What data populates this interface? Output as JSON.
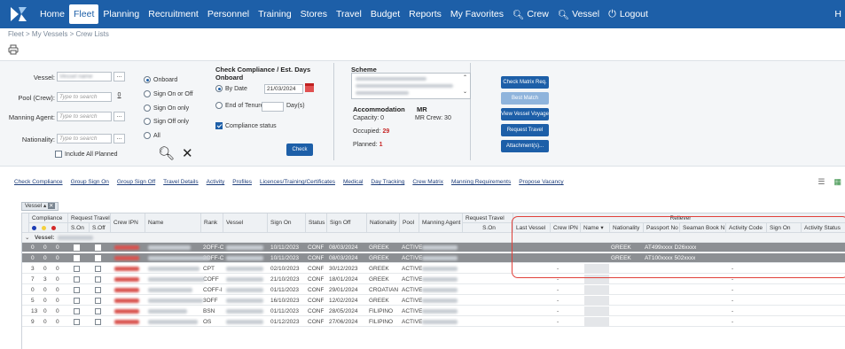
{
  "nav": {
    "items": [
      "Home",
      "Fleet",
      "Planning",
      "Recruitment",
      "Personnel",
      "Training",
      "Stores",
      "Travel",
      "Budget",
      "Reports",
      "My Favorites",
      "Crew",
      "Vessel",
      "Logout"
    ],
    "active": "Fleet",
    "right_text": "H"
  },
  "breadcrumb": "Fleet > My Vessels > Crew Lists",
  "filters": {
    "vessel_label": "Vessel:",
    "pool_label": "Pool (Crew):",
    "pool_placeholder": "Type to search",
    "pool_count": "0",
    "manning_label": "Manning Agent:",
    "manning_placeholder": "Type to search",
    "nationality_label": "Nationality:",
    "nationality_placeholder": "Type to search",
    "include_all_planned": "Include All Planned",
    "radios": [
      "Onboard",
      "Sign On or Off",
      "Sign On only",
      "Sign Off only",
      "All"
    ],
    "radio_selected": "Onboard"
  },
  "compliance": {
    "title": "Check Compliance / Est. Days Onboard",
    "by_date": "By Date",
    "date_value": "21/03/2024",
    "end_of_tenure": "End of Tenure",
    "days_label": "Day(s)",
    "compliance_status": "Compliance status",
    "check_button": "Check"
  },
  "scheme": {
    "title": "Scheme",
    "accommodation": "Accommodation",
    "mr": "MR",
    "capacity": "Capacity: 0",
    "mr_crew": "MR Crew: 30",
    "occupied_label": "Occupied:",
    "occupied_value": "29",
    "planned_label": "Planned:",
    "planned_value": "1"
  },
  "action_buttons": [
    "Check Matrix Req.",
    "Best Match",
    "View Vessel Voyage",
    "Request Travel",
    "Attachment(s)..."
  ],
  "links": [
    "Check Compliance",
    "Group Sign On",
    "Group Sign Off",
    "Travel Details",
    "Activity",
    "Profiles",
    "Licences/Training/Certificates",
    "Medical",
    "Day Tracking",
    "Crew Matrix",
    "Manning Requirements",
    "Propose Vacancy"
  ],
  "grid": {
    "tab_label": "Vessel",
    "group_compliance": "Compliance",
    "group_request_travel": "Request Travel",
    "group_request_travel2": "Request Travel",
    "group_reliever": "Reliever",
    "headers": {
      "son": "S.On",
      "soff": "S.Off",
      "crew_ipn": "Crew IPN",
      "name": "Name",
      "rank": "Rank",
      "vessel": "Vessel",
      "sign_on": "Sign On",
      "status": "Status",
      "sign_off": "Sign Off",
      "nationality": "Nationality",
      "pool": "Pool",
      "manning_agent": "Manning Agent",
      "rt_son": "S.On",
      "last_vessel": "Last Vessel",
      "r_crew_ipn": "Crew IPN",
      "r_name": "Name",
      "r_nationality": "Nationality",
      "passport": "Passport No",
      "seaman": "Seaman Book N",
      "activity_code": "Activity Code",
      "r_sign_on": "Sign On",
      "activity_status": "Activity Status"
    },
    "group_row_label": "Vessel:",
    "rows": [
      {
        "c1": "0",
        "c2": "0",
        "c3": "0",
        "rank": "2OFF-C",
        "sign_on": "10/11/2023",
        "status": "CONF",
        "sign_off": "08/03/2024",
        "nationality": "GREEK",
        "pool": "ACTIVE",
        "r_nat": "GREEK",
        "r_pass": "AT499xxxx D26xxxx",
        "dark": true
      },
      {
        "c1": "0",
        "c2": "0",
        "c3": "0",
        "rank": "2OFF-C",
        "sign_on": "10/11/2023",
        "status": "CONF",
        "sign_off": "08/03/2024",
        "nationality": "GREEK",
        "pool": "ACTIVE",
        "r_nat": "GREEK",
        "r_pass": "AT100xxxx 502xxxx",
        "dark": true
      },
      {
        "c1": "3",
        "c2": "0",
        "c3": "0",
        "rank": "CPT",
        "sign_on": "02/10/2023",
        "status": "CONF",
        "sign_off": "30/12/2023",
        "nationality": "GREEK",
        "pool": "ACTIVE",
        "r_nat": "",
        "r_pass": "",
        "dark": false
      },
      {
        "c1": "7",
        "c2": "3",
        "c3": "0",
        "rank": "COFF",
        "sign_on": "21/10/2023",
        "status": "CONF",
        "sign_off": "18/01/2024",
        "nationality": "GREEK",
        "pool": "ACTIVE",
        "r_nat": "",
        "r_pass": "",
        "dark": false
      },
      {
        "c1": "0",
        "c2": "0",
        "c3": "0",
        "rank": "COFF-I",
        "sign_on": "01/11/2023",
        "status": "CONF",
        "sign_off": "29/01/2024",
        "nationality": "CROATIAN",
        "pool": "ACTIVE",
        "r_nat": "",
        "r_pass": "",
        "dark": false
      },
      {
        "c1": "5",
        "c2": "0",
        "c3": "0",
        "rank": "3OFF",
        "sign_on": "16/10/2023",
        "status": "CONF",
        "sign_off": "12/02/2024",
        "nationality": "GREEK",
        "pool": "ACTIVE",
        "r_nat": "",
        "r_pass": "",
        "dark": false
      },
      {
        "c1": "13",
        "c2": "0",
        "c3": "0",
        "rank": "BSN",
        "sign_on": "01/11/2023",
        "status": "CONF",
        "sign_off": "28/05/2024",
        "nationality": "FILIPINO",
        "pool": "ACTIVE",
        "r_nat": "",
        "r_pass": "",
        "dark": false
      },
      {
        "c1": "9",
        "c2": "0",
        "c3": "0",
        "rank": "OS",
        "sign_on": "01/12/2023",
        "status": "CONF",
        "sign_off": "27/06/2024",
        "nationality": "FILIPINO",
        "pool": "ACTIVE",
        "r_nat": "",
        "r_pass": "",
        "dark": false
      }
    ]
  },
  "colors": {
    "nav_blue": "#1d5fa8",
    "highlight_red": "#e0413a",
    "occupied_red": "#c62828",
    "dot_blue": "#1a3bb5",
    "dot_yellow": "#f4d03f",
    "dot_red": "#d42a2a"
  }
}
